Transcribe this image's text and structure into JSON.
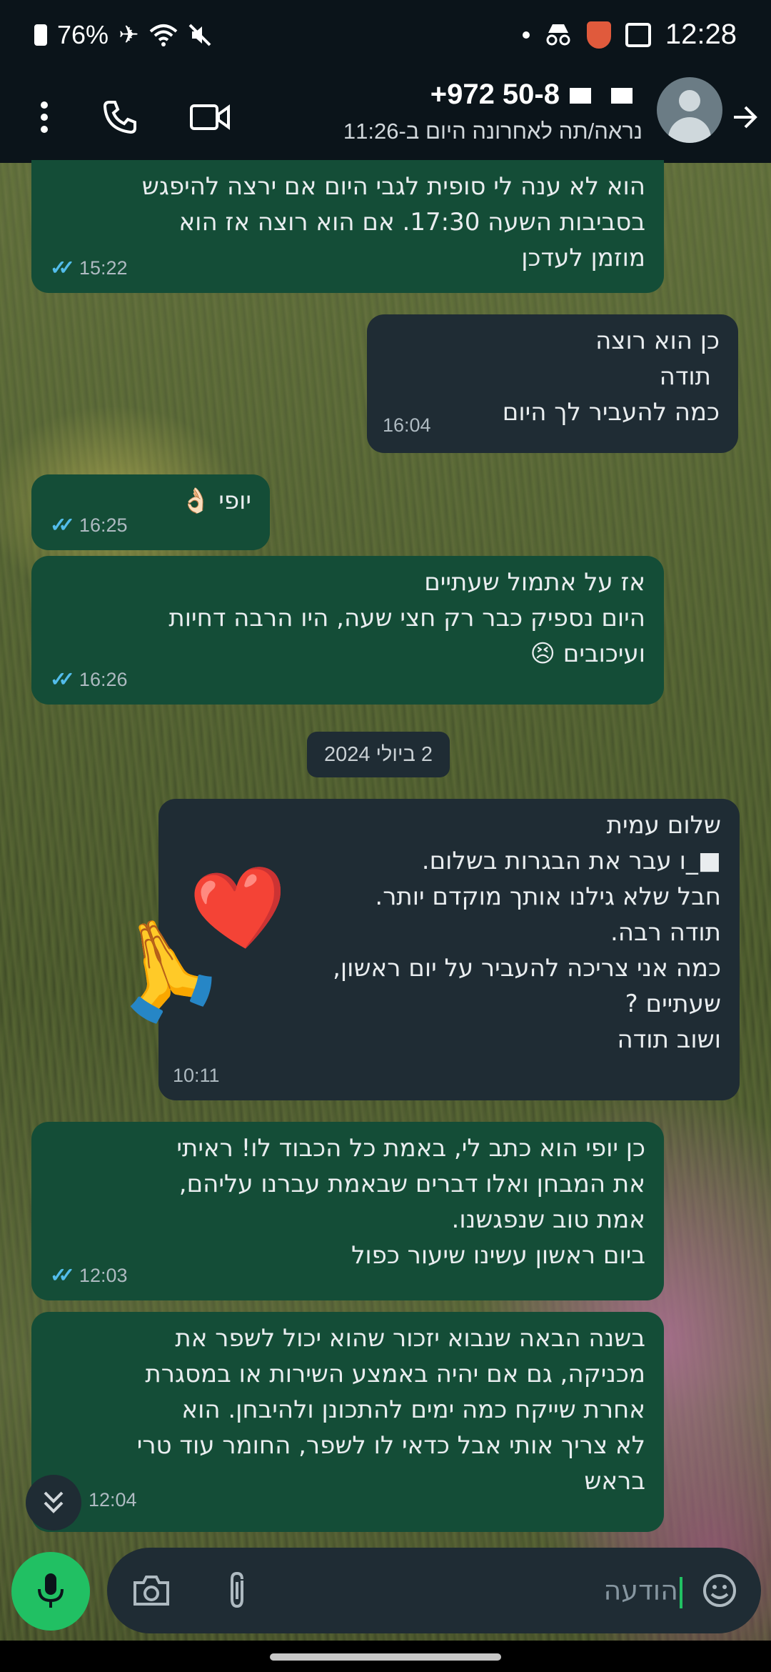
{
  "status_bar": {
    "battery": "76%",
    "time": "12:28"
  },
  "header": {
    "contact_name": "+972 50-8",
    "last_seen": "נראה/תה לאחרונה היום ב-11:26"
  },
  "messages": [
    {
      "direction": "out",
      "lines": [
        "הוא לא ענה לי סופית לגבי היום אם ירצה להיפגש",
        "בסביבות השעה 17:30. אם הוא רוצה אז הוא",
        "מוזמן לעדכן"
      ],
      "time": "15:22",
      "read": true
    },
    {
      "direction": "in",
      "lines": [
        "כן הוא רוצה",
        "תודה",
        "כמה להעביר לך היום"
      ],
      "time": "16:04"
    },
    {
      "direction": "out",
      "lines": [
        "יופי 👌🏻"
      ],
      "time": "16:25",
      "read": true
    },
    {
      "direction": "out",
      "lines": [
        "אז על אתמול שעתיים",
        "היום נספיק כבר רק חצי שעה, היו הרבה דחיות",
        "ועיכובים 😣"
      ],
      "time": "16:26",
      "read": true
    },
    {
      "direction": "in",
      "lines": [
        "שלום עמית",
        "■_ו עבר את הבגרות בשלום.",
        "חבל שלא גילנו אותך מוקדם יותר.",
        "תודה רבה.",
        "כמה אני צריכה להעביר על יום ראשון,",
        "שעתיים ?",
        "ושוב תודה"
      ],
      "time": "10:11",
      "stickers": [
        "❤️",
        "🙏"
      ]
    },
    {
      "direction": "out",
      "lines": [
        "כן יופי הוא כתב לי, באמת כל הכבוד לו! ראיתי",
        "את המבחן ואלו דברים שבאמת עברנו עליהם,",
        "אמת טוב שנפגשנו.",
        "ביום ראשון עשינו שיעור כפול"
      ],
      "time": "12:03",
      "read": true
    },
    {
      "direction": "out",
      "lines": [
        "בשנה הבאה שנבוא יזכור שהוא יכול לשפר את",
        "מכניקה, גם אם יהיה באמצע השירות או במסגרת",
        "אחרת שייקח כמה ימים להתכונן ולהיבחן. הוא",
        "לא צריך אותי אבל כדאי לו לשפר, החומר עוד טרי",
        "בראש"
      ],
      "time": "12:04"
    }
  ],
  "date_chip": "2 ביולי 2024",
  "composer": {
    "placeholder": "הודעה"
  },
  "colors": {
    "outgoing_bubble": "#144d37",
    "incoming_bubble": "#1f2c34",
    "accent": "#21c063",
    "read_ticks": "#53bdeb"
  }
}
